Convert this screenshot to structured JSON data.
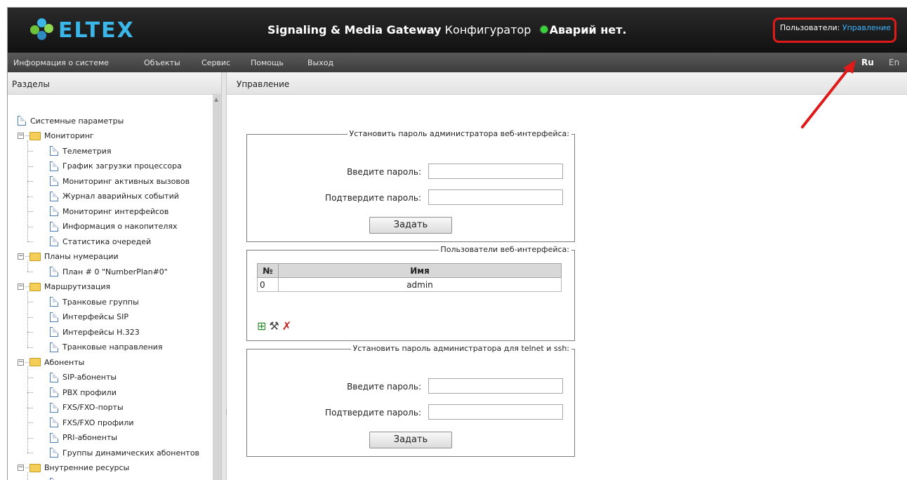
{
  "header": {
    "brand": "ELTEX",
    "product_title": "Signaling & Media Gateway",
    "configurator": "Конфигуратор",
    "alarm_status": "Аварий нет.",
    "users_label": "Пользователи:",
    "users_link": "Управление"
  },
  "menu": {
    "items": [
      "Информация о системе",
      "Объекты",
      "Сервис",
      "Помощь",
      "Выход"
    ],
    "lang_ru": "Ru",
    "lang_en": "En"
  },
  "left_panel": {
    "title": "Разделы",
    "tree": [
      {
        "label": "Системные параметры",
        "type": "doc",
        "level": 0
      },
      {
        "label": "Мониторинг",
        "type": "folder",
        "level": 0
      },
      {
        "label": "Телеметрия",
        "type": "doc",
        "level": 1
      },
      {
        "label": "График загрузки процессора",
        "type": "doc",
        "level": 1
      },
      {
        "label": "Мониторинг активных вызовов",
        "type": "doc",
        "level": 1
      },
      {
        "label": "Журнал аварийных событий",
        "type": "doc",
        "level": 1
      },
      {
        "label": "Мониторинг интерфейсов",
        "type": "doc",
        "level": 1
      },
      {
        "label": "Информация о накопителях",
        "type": "doc",
        "level": 1
      },
      {
        "label": "Статистика очередей",
        "type": "doc",
        "level": 1
      },
      {
        "label": "Планы нумерации",
        "type": "folder",
        "level": 0
      },
      {
        "label": "План # 0 \"NumberPlan#0\"",
        "type": "doc",
        "level": 1
      },
      {
        "label": "Маршрутизация",
        "type": "folder",
        "level": 0
      },
      {
        "label": "Транковые группы",
        "type": "doc",
        "level": 1
      },
      {
        "label": "Интерфейсы SIP",
        "type": "doc",
        "level": 1
      },
      {
        "label": "Интерфейсы H.323",
        "type": "doc",
        "level": 1
      },
      {
        "label": "Транковые направления",
        "type": "doc",
        "level": 1
      },
      {
        "label": "Абоненты",
        "type": "folder",
        "level": 0
      },
      {
        "label": "SIP-абоненты",
        "type": "doc",
        "level": 1
      },
      {
        "label": "PBX профили",
        "type": "doc",
        "level": 1
      },
      {
        "label": "FXS/FXO-порты",
        "type": "doc",
        "level": 1
      },
      {
        "label": "FXS/FXO профили",
        "type": "doc",
        "level": 1
      },
      {
        "label": "PRI-абоненты",
        "type": "doc",
        "level": 1
      },
      {
        "label": "Группы динамических абонентов",
        "type": "doc",
        "level": 1
      },
      {
        "label": "Внутренние ресурсы",
        "type": "folder",
        "level": 0
      },
      {
        "label": "CDR-записи",
        "type": "doc",
        "level": 1
      }
    ]
  },
  "right_panel": {
    "title": "Управление",
    "web_pass": {
      "legend": "Установить пароль администратора веб-интерфейса:",
      "enter_label": "Введите пароль:",
      "confirm_label": "Подтвердите пароль:",
      "button": "Задать"
    },
    "web_users": {
      "legend": "Пользователи веб-интерфейса:",
      "columns": [
        "№",
        "Имя"
      ],
      "rows": [
        [
          "0",
          "admin"
        ]
      ]
    },
    "ssh_pass": {
      "legend": "Установить пароль администратора для telnet и ssh:",
      "enter_label": "Введите пароль:",
      "confirm_label": "Подтвердите пароль:",
      "button": "Задать"
    }
  }
}
